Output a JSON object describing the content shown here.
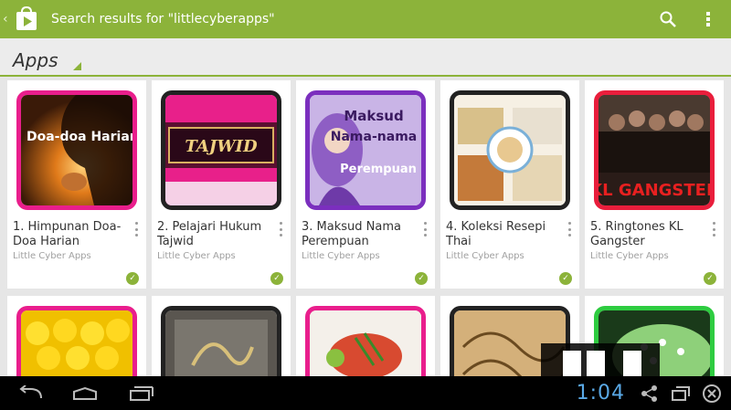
{
  "actionbar": {
    "title": "Search results for \"littlecyberapps\"",
    "color": "#8cb33a"
  },
  "section": {
    "title": "Apps"
  },
  "apps_row1": [
    {
      "name": "1. Himpunan Doa-Doa Harian",
      "developer": "Little Cyber Apps",
      "thumb_text": "Doa-doa Harian",
      "border": "#e91e8c"
    },
    {
      "name": "2. Pelajari Hukum Tajwid",
      "developer": "Little Cyber Apps",
      "thumb_text": "TAJWID",
      "border": "#222222"
    },
    {
      "name": "3. Maksud Nama Perempuan",
      "developer": "Little Cyber Apps",
      "thumb_text": "Maksud Nama-nama Perempuan",
      "border": "#7b2fbe"
    },
    {
      "name": "4. Koleksi Resepi Thai",
      "developer": "Little Cyber Apps",
      "thumb_text": "",
      "border": "#222222"
    },
    {
      "name": "5. Ringtones KL Gangster",
      "developer": "Little Cyber Apps",
      "thumb_text": "KL GANGSTER",
      "border": "#e91e3c"
    }
  ],
  "apps_row2": [
    {
      "border": "#e91e8c"
    },
    {
      "border": "#222222"
    },
    {
      "border": "#e91e8c"
    },
    {
      "border": "#222222"
    },
    {
      "border": "#2ecc40"
    }
  ],
  "navbar": {
    "clock": "1:04"
  }
}
